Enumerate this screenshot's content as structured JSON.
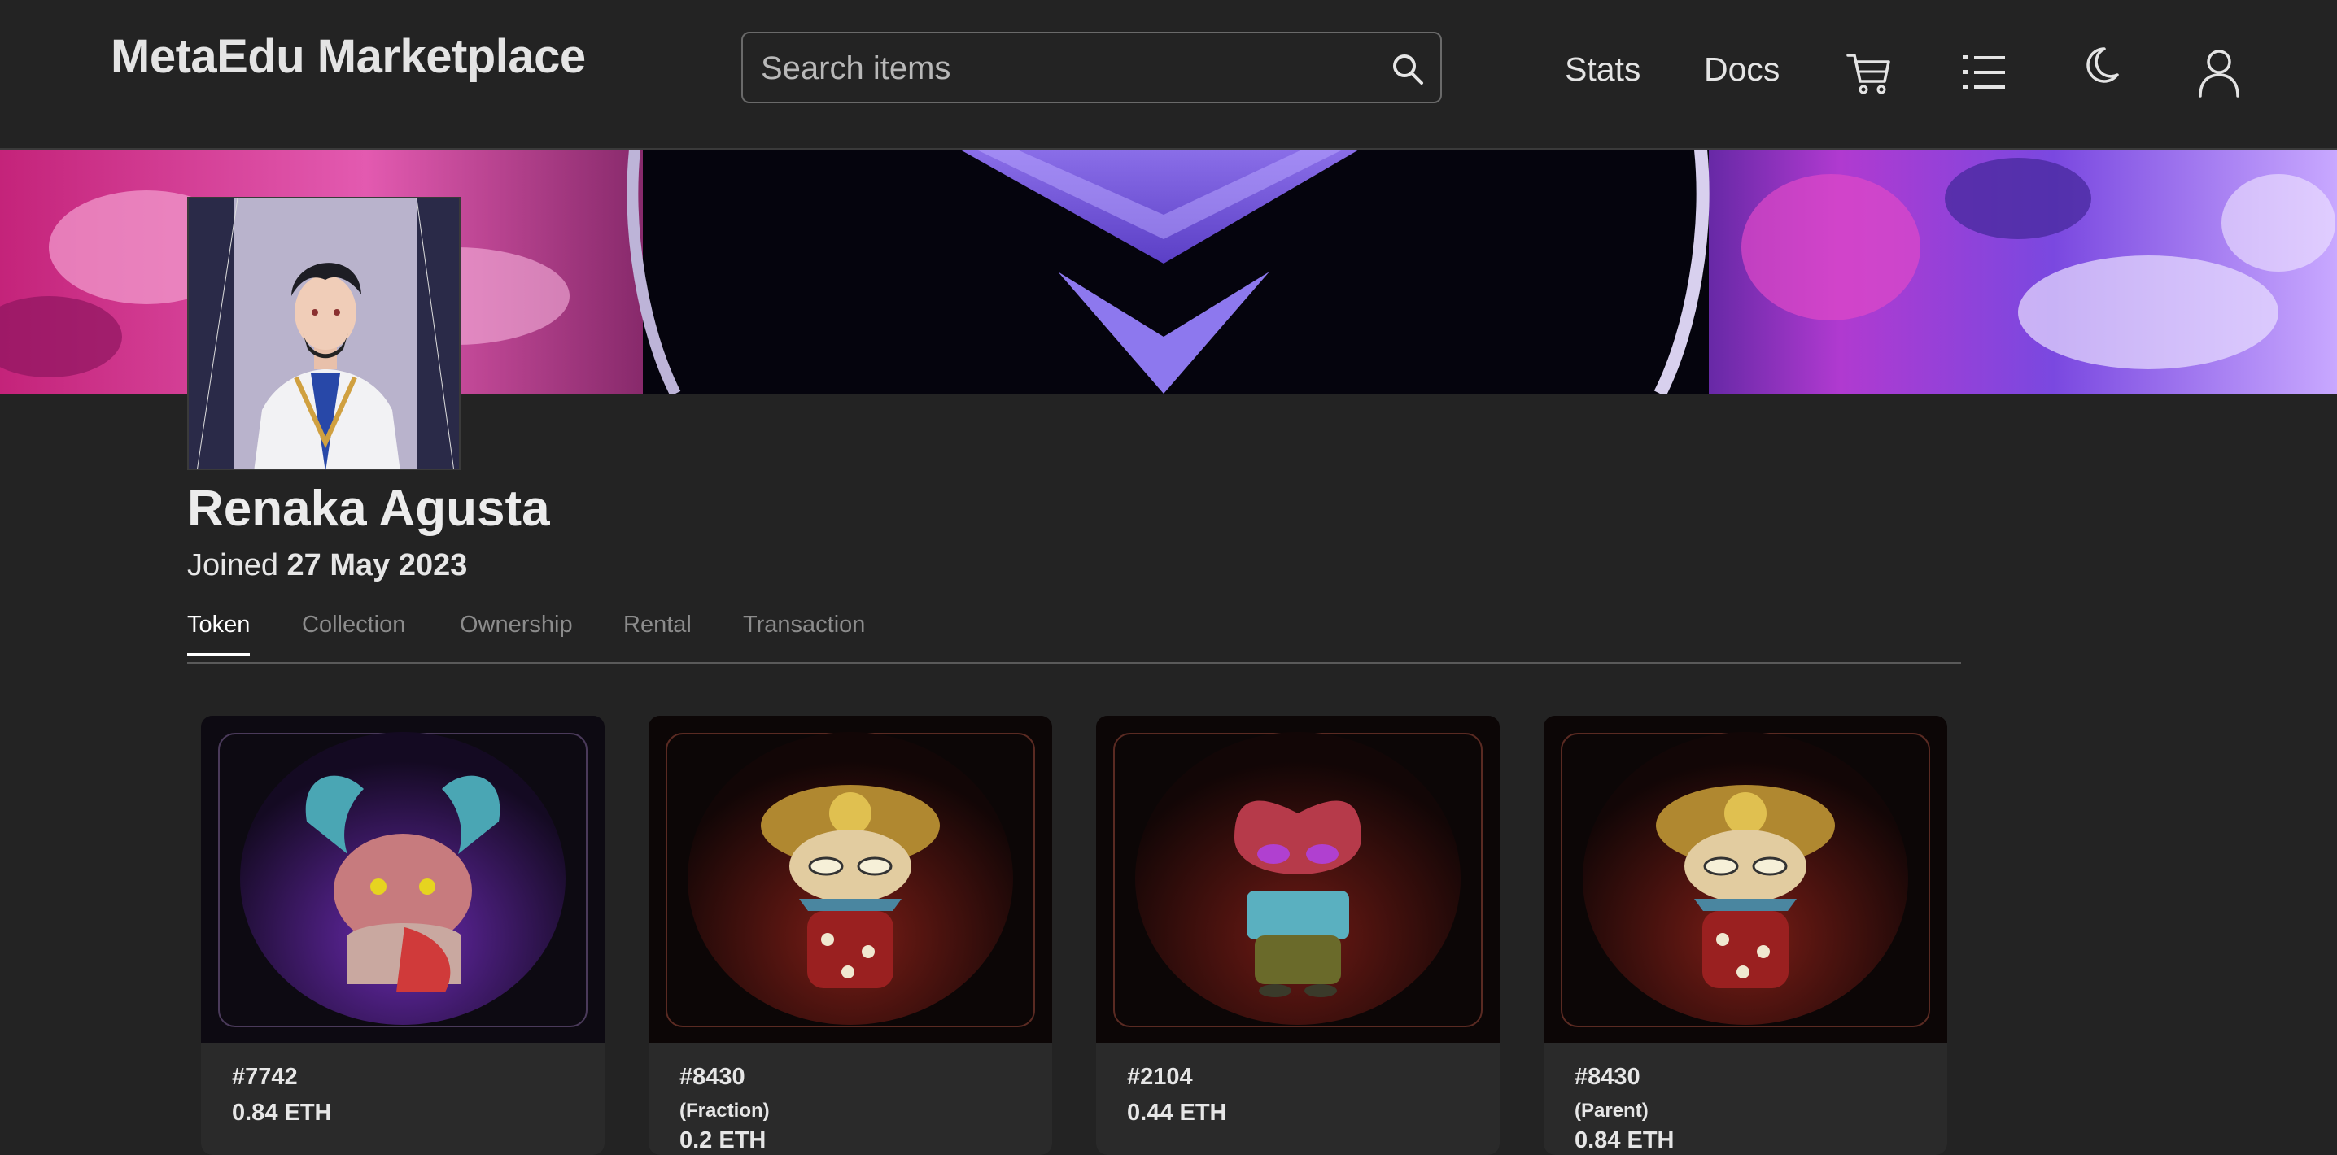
{
  "navbar": {
    "brand": "MetaEdu Marketplace",
    "search_placeholder": "Search items",
    "links": [
      "Stats",
      "Docs"
    ],
    "icons": [
      "search-icon",
      "cart-icon",
      "list-icon",
      "moon-icon",
      "user-icon"
    ]
  },
  "profile": {
    "name": "Renaka Agusta",
    "joined_prefix": "Joined",
    "joined_date": "27 May 2023"
  },
  "tabs": [
    {
      "label": "Token",
      "active": true
    },
    {
      "label": "Collection",
      "active": false
    },
    {
      "label": "Ownership",
      "active": false
    },
    {
      "label": "Rental",
      "active": false
    },
    {
      "label": "Transaction",
      "active": false
    }
  ],
  "cards": [
    {
      "id": "#7742",
      "subtitle": "",
      "price": "0.84 ETH",
      "theme": "purple"
    },
    {
      "id": "#8430",
      "subtitle": "(Fraction)",
      "price": "0.2 ETH",
      "theme": "red"
    },
    {
      "id": "#2104",
      "subtitle": "",
      "price": "0.44 ETH",
      "theme": "red"
    },
    {
      "id": "#8430",
      "subtitle": "(Parent)",
      "price": "0.84 ETH",
      "theme": "red"
    }
  ],
  "colors": {
    "background": "#232323",
    "card_info": "#2a2a2a",
    "text": "#e6e6e6",
    "tab_inactive": "#8c8c8c"
  }
}
